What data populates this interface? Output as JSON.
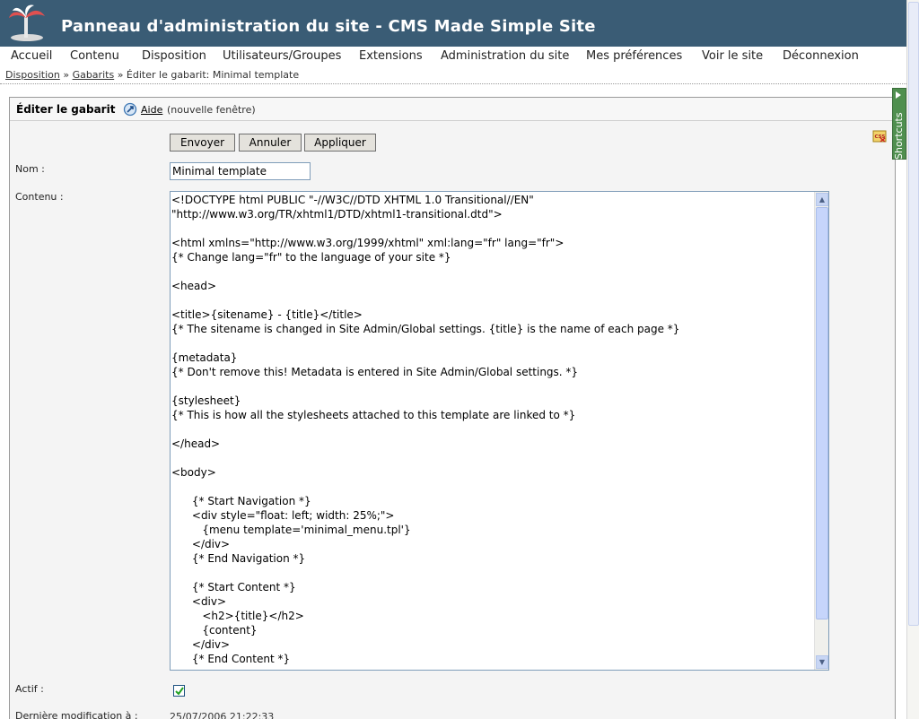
{
  "header": {
    "title": "Panneau d'administration du site - CMS Made Simple Site"
  },
  "menu": {
    "items": [
      "Accueil",
      "Contenu",
      "Disposition",
      "Utilisateurs/Groupes",
      "Extensions",
      "Administration du site",
      "Mes préférences",
      "Voir le site",
      "Déconnexion"
    ]
  },
  "breadcrumb": {
    "item1": "Disposition",
    "sep1": "»",
    "item2": "Gabarits",
    "sep2": "»",
    "current": "Éditer le gabarit: Minimal template"
  },
  "panel": {
    "title": "Éditer le gabarit",
    "help_link": "Aide",
    "help_note": "(nouvelle fenêtre)"
  },
  "buttons": {
    "submit": "Envoyer",
    "cancel": "Annuler",
    "apply": "Appliquer"
  },
  "form": {
    "name_label": "Nom :",
    "name_value": "Minimal template",
    "content_label": "Contenu :",
    "active_label": "Actif :",
    "active_checked": true,
    "lastmod_label": "Dernière modification à :",
    "lastmod_value": "25/07/2006 21:22:33",
    "content_lines": [
      "<!DOCTYPE html PUBLIC \"-//W3C//DTD XHTML 1.0 Transitional//EN\"",
      "\"http://www.w3.org/TR/xhtml1/DTD/xhtml1-transitional.dtd\">",
      "",
      "<html xmlns=\"http://www.w3.org/1999/xhtml\" xml:lang=\"fr\" lang=\"fr\">",
      "{* Change lang=\"fr\" to the language of your site *}",
      "",
      "<head>",
      "",
      "<title>{sitename} - {title}</title>",
      "{* The sitename is changed in Site Admin/Global settings. {title} is the name of each page *}",
      "",
      "{metadata}",
      "{* Don't remove this! Metadata is entered in Site Admin/Global settings. *}",
      "",
      "{stylesheet}",
      "{* This is how all the stylesheets attached to this template are linked to *}",
      "",
      "</head>",
      "",
      "<body>",
      "",
      "      {* Start Navigation *}",
      "      <div style=\"float: left; width: 25%;\">",
      "         {menu template='minimal_menu.tpl'}",
      "      </div>",
      "      {* End Navigation *}",
      "",
      "      {* Start Content *}",
      "      <div>",
      "         <h2>{title}</h2>",
      "         {content}",
      "      </div>",
      "      {* End Content *}"
    ]
  },
  "sidebar": {
    "shortcuts_label": "Shortcuts"
  },
  "colors": {
    "header_bg": "#3a5c75",
    "shortcuts_bg": "#4f8f4f",
    "button_bg": "#e4e2dc"
  }
}
